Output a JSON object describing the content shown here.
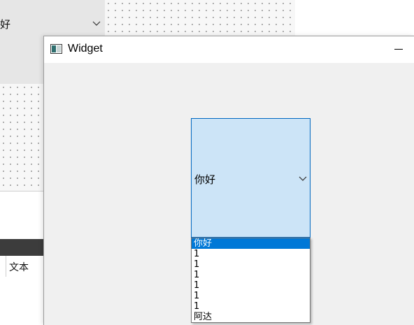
{
  "designer": {
    "combo_text": "好",
    "table_cell": "文本"
  },
  "window": {
    "title": "Widget"
  },
  "combo": {
    "current_text": "你好"
  },
  "dropdown": {
    "items": [
      "你好",
      "1",
      "1",
      "1",
      "1",
      "1",
      "1",
      "阿达"
    ],
    "selected_index": 0
  },
  "colors": {
    "combo_bg": "#cce4f7",
    "combo_border": "#0067c0",
    "selection": "#0078d7"
  }
}
